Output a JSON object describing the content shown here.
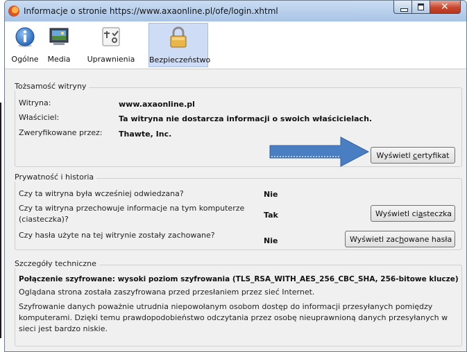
{
  "window": {
    "title": "Informacje o stronie https://www.axaonline.pl/ofe/login.xhtml"
  },
  "tabs": [
    {
      "label": "Ogólne",
      "icon": "info-icon"
    },
    {
      "label": "Media",
      "icon": "media-icon"
    },
    {
      "label": "Uprawnienia",
      "icon": "permissions-icon"
    },
    {
      "label": "Bezpieczeństwo",
      "icon": "padlock-icon",
      "active": true
    }
  ],
  "identity": {
    "title": "Tożsamość witryny",
    "site_label": "Witryna:",
    "site_value": "www.axaonline.pl",
    "owner_label": "Właściciel:",
    "owner_value": "Ta witryna nie dostarcza informacji o swoich właścicielach.",
    "verified_label": "Zweryfikowane przez:",
    "verified_value": "Thawte, Inc.",
    "cert_button_pre": "Wyświetl ",
    "cert_button_accel": "c",
    "cert_button_post": "ertyfikat"
  },
  "privacy": {
    "title": "Prywatność i historia",
    "rows": [
      {
        "question": "Czy ta witryna była wcześniej odwiedzana?",
        "answer": "Nie"
      },
      {
        "question": "Czy ta witryna przechowuje informacje na tym komputerze (ciasteczka)?",
        "answer": "Tak"
      },
      {
        "question": "Czy hasła użyte na tej witrynie zostały zachowane?",
        "answer": "Nie"
      }
    ],
    "cookies_button_pre": "Wyświetl ci",
    "cookies_button_accel": "a",
    "cookies_button_post": "steczka",
    "passwords_button_pre": "Wyświetl zac",
    "passwords_button_accel": "h",
    "passwords_button_post": "owane hasła"
  },
  "technical": {
    "title": "Szczegóły techniczne",
    "line1": "Połączenie szyfrowane: wysoki poziom szyfrowania (TLS_RSA_WITH_AES_256_CBC_SHA, 256-bitowe klucze)",
    "line2": "Oglądana strona została zaszyfrowana przed przesłaniem przez sieć Internet.",
    "line3": "Szyfrowanie danych poważnie utrudnia niepowołanym osobom dostęp do informacji przesyłanych pomiędzy komputerami. Dzięki temu prawdopodobieństwo odczytania przez osobę nieuprawnioną danych przesyłanych w sieci jest bardzo niskie."
  },
  "colors": {
    "arrow": "#4a7ec2",
    "active_tab": "#cfdcf6",
    "close_button": "#c9462c"
  }
}
